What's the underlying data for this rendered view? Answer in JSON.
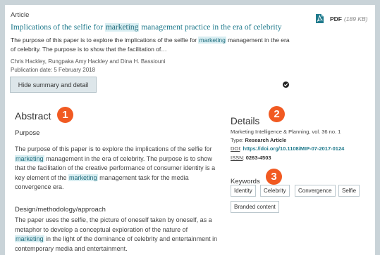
{
  "article": {
    "label": "Article",
    "title_before": "Implications of the selfie for ",
    "title_mark": "marketing",
    "title_after": " management practice in the era of celebrity",
    "pdf_label": "PDF",
    "pdf_size": "(189 KB)",
    "summary_part1": "The purpose of this paper is to explore the implications of the selfie for ",
    "summary_mark": "marketing",
    "summary_part2": " management in the era of celebrity. The purpose is to show that the facilitation of…",
    "authors": "Chris Hackley, Rungpaka Amy Hackley and Dina H. Bassiouni",
    "publication_date": "Publication date: 5 February 2018",
    "hide_button": "Hide summary and detail"
  },
  "abstract": {
    "heading": "Abstract",
    "badge": "1",
    "purpose_heading": "Purpose",
    "purpose_p1": "The purpose of this paper is to explore the implications of the selfie for ",
    "purpose_mark1": "marketing",
    "purpose_p2": " management in the era of celebrity. The purpose is to show that the facilitation of the creative performance of consumer identity is a key element of the ",
    "purpose_mark2": "marketing",
    "purpose_p3": " management task for the media convergence era.",
    "design_heading": "Design/methodology/approach",
    "design_p1": "The paper uses the selfie, the picture of oneself taken by oneself, as a metaphor to develop a conceptual exploration of the nature of ",
    "design_mark": "marketing",
    "design_p2": " in the light of the dominance of celebrity and entertainment in contemporary media and entertainment."
  },
  "details": {
    "heading": "Details",
    "badge": "2",
    "journal": "Marketing Intelligence & Planning, vol. 36 no. 1",
    "type_label": "Type:",
    "type_value": "Research Article",
    "doi_label": "DOI",
    "doi_value": "https://doi.org/10.1108/MIP-07-2017-0124",
    "issn_label": "ISSN",
    "issn_value": "0263-4503"
  },
  "keywords": {
    "heading": "Keywords",
    "badge": "3",
    "items": [
      "Identity",
      "Celebrity",
      "Convergence",
      "Selfie",
      "Branded content"
    ]
  },
  "colors": {
    "accent": "#1f7a8c",
    "badge": "#f15a22",
    "highlight": "#d8eef2",
    "background": "#c9d3d8"
  },
  "icons": {
    "pdf": "pdf-file-icon",
    "status": "check-circle-icon"
  }
}
